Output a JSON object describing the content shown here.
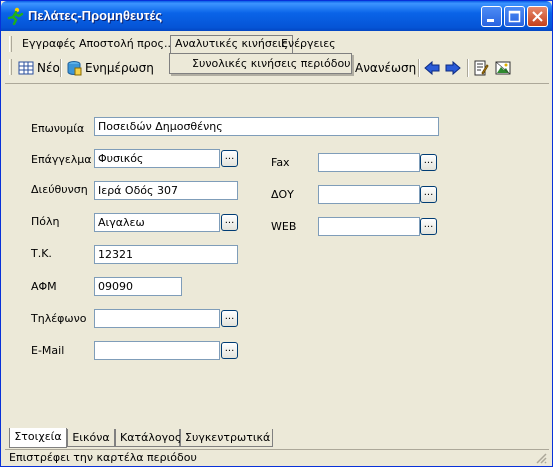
{
  "window": {
    "title": "Πελάτες-Προμηθευτές"
  },
  "menu": {
    "items": [
      {
        "label": "Εγγραφές"
      },
      {
        "label": "Αποστολή προς..."
      },
      {
        "label": "Αναλυτικές κινήσεις"
      },
      {
        "label": "Ενέργειες"
      }
    ],
    "dropdown_item": "Συνολικές κινήσεις περιόδου"
  },
  "toolbar": {
    "new_label": "Νέο",
    "update_label": "Ενημέρωση",
    "refresh_label": "Ανανέωση"
  },
  "form": {
    "name": {
      "label": "Επωνυμία",
      "value": "Ποσειδών Δημοσθένης"
    },
    "profession": {
      "label": "Επάγγελμα",
      "value": "Φυσικός"
    },
    "address": {
      "label": "Διεύθυνση",
      "value": "Ιερά Οδός 307"
    },
    "city": {
      "label": "Πόλη",
      "value": "Αιγαλεω"
    },
    "postal": {
      "label": "Τ.Κ.",
      "value": "12321"
    },
    "afm": {
      "label": "ΑΦΜ",
      "value": "09090"
    },
    "phone": {
      "label": "Τηλέφωνο",
      "value": ""
    },
    "email": {
      "label": "E-Mail",
      "value": ""
    },
    "fax": {
      "label": "Fax",
      "value": ""
    },
    "doy": {
      "label": "ΔΟΥ",
      "value": ""
    },
    "web": {
      "label": "WEB",
      "value": ""
    },
    "ellipsis": "..."
  },
  "tabs": [
    {
      "label": "Στοιχεία"
    },
    {
      "label": "Εικόνα"
    },
    {
      "label": "Κατάλογος"
    },
    {
      "label": "Συγκεντρωτικά"
    }
  ],
  "status": {
    "text": "Επιστρέφει την καρτέλα περιόδου"
  },
  "colors": {
    "titlebar": "#0554d6",
    "face": "#ece9d8",
    "field_border": "#7f9db9"
  }
}
